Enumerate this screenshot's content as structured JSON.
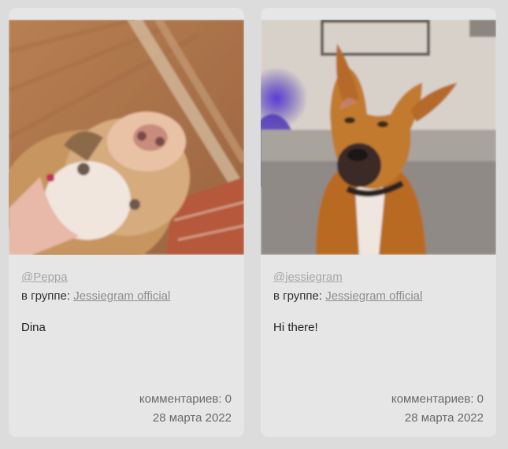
{
  "posts": [
    {
      "author": "@Peppa",
      "group_prefix": "в группе:",
      "group_name": "Jessiegram official",
      "text": "Dina",
      "comments_label": "комментариев: 0",
      "date": "28 марта 2022"
    },
    {
      "author": "@jessiegram",
      "group_prefix": "в группе:",
      "group_name": "Jessiegram official",
      "text": "Hi there!",
      "comments_label": "комментариев: 0",
      "date": "28 марта 2022"
    }
  ]
}
